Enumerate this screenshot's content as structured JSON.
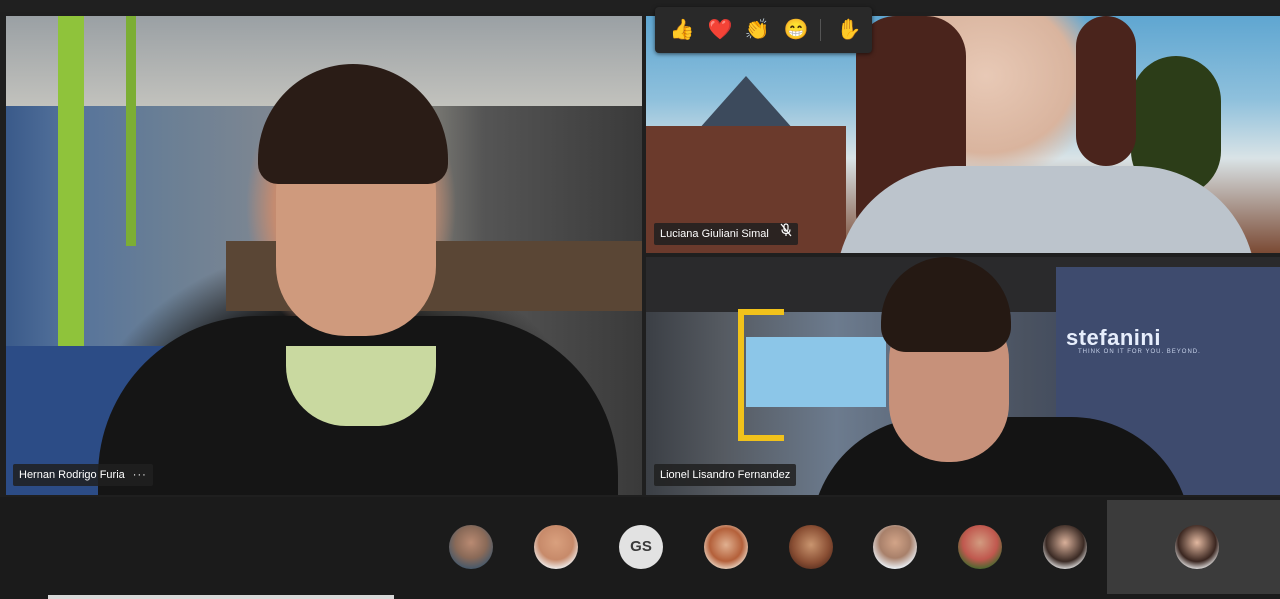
{
  "participants": {
    "hernan": {
      "name": "Hernan Rodrigo Furia",
      "more_label": "···"
    },
    "luciana": {
      "name": "Luciana Giuliani Simal",
      "muted": true
    },
    "lionel": {
      "name": "Lionel Lisandro Fernandez"
    }
  },
  "background_branding": {
    "logo_text": "stefanini",
    "tagline": "THINK ON IT FOR YOU. BEYOND."
  },
  "reactions": [
    {
      "name": "like",
      "glyph": "👍"
    },
    {
      "name": "heart",
      "glyph": "❤️"
    },
    {
      "name": "applause",
      "glyph": "👏"
    },
    {
      "name": "laugh",
      "glyph": "😁"
    },
    {
      "name": "raise-hand",
      "glyph": "✋"
    }
  ],
  "participant_strip": {
    "initials_avatar": "GS"
  },
  "colors": {
    "tile_label_bg": "#202020",
    "strip_bg": "#1b1b1b",
    "heart": "#e81123"
  }
}
